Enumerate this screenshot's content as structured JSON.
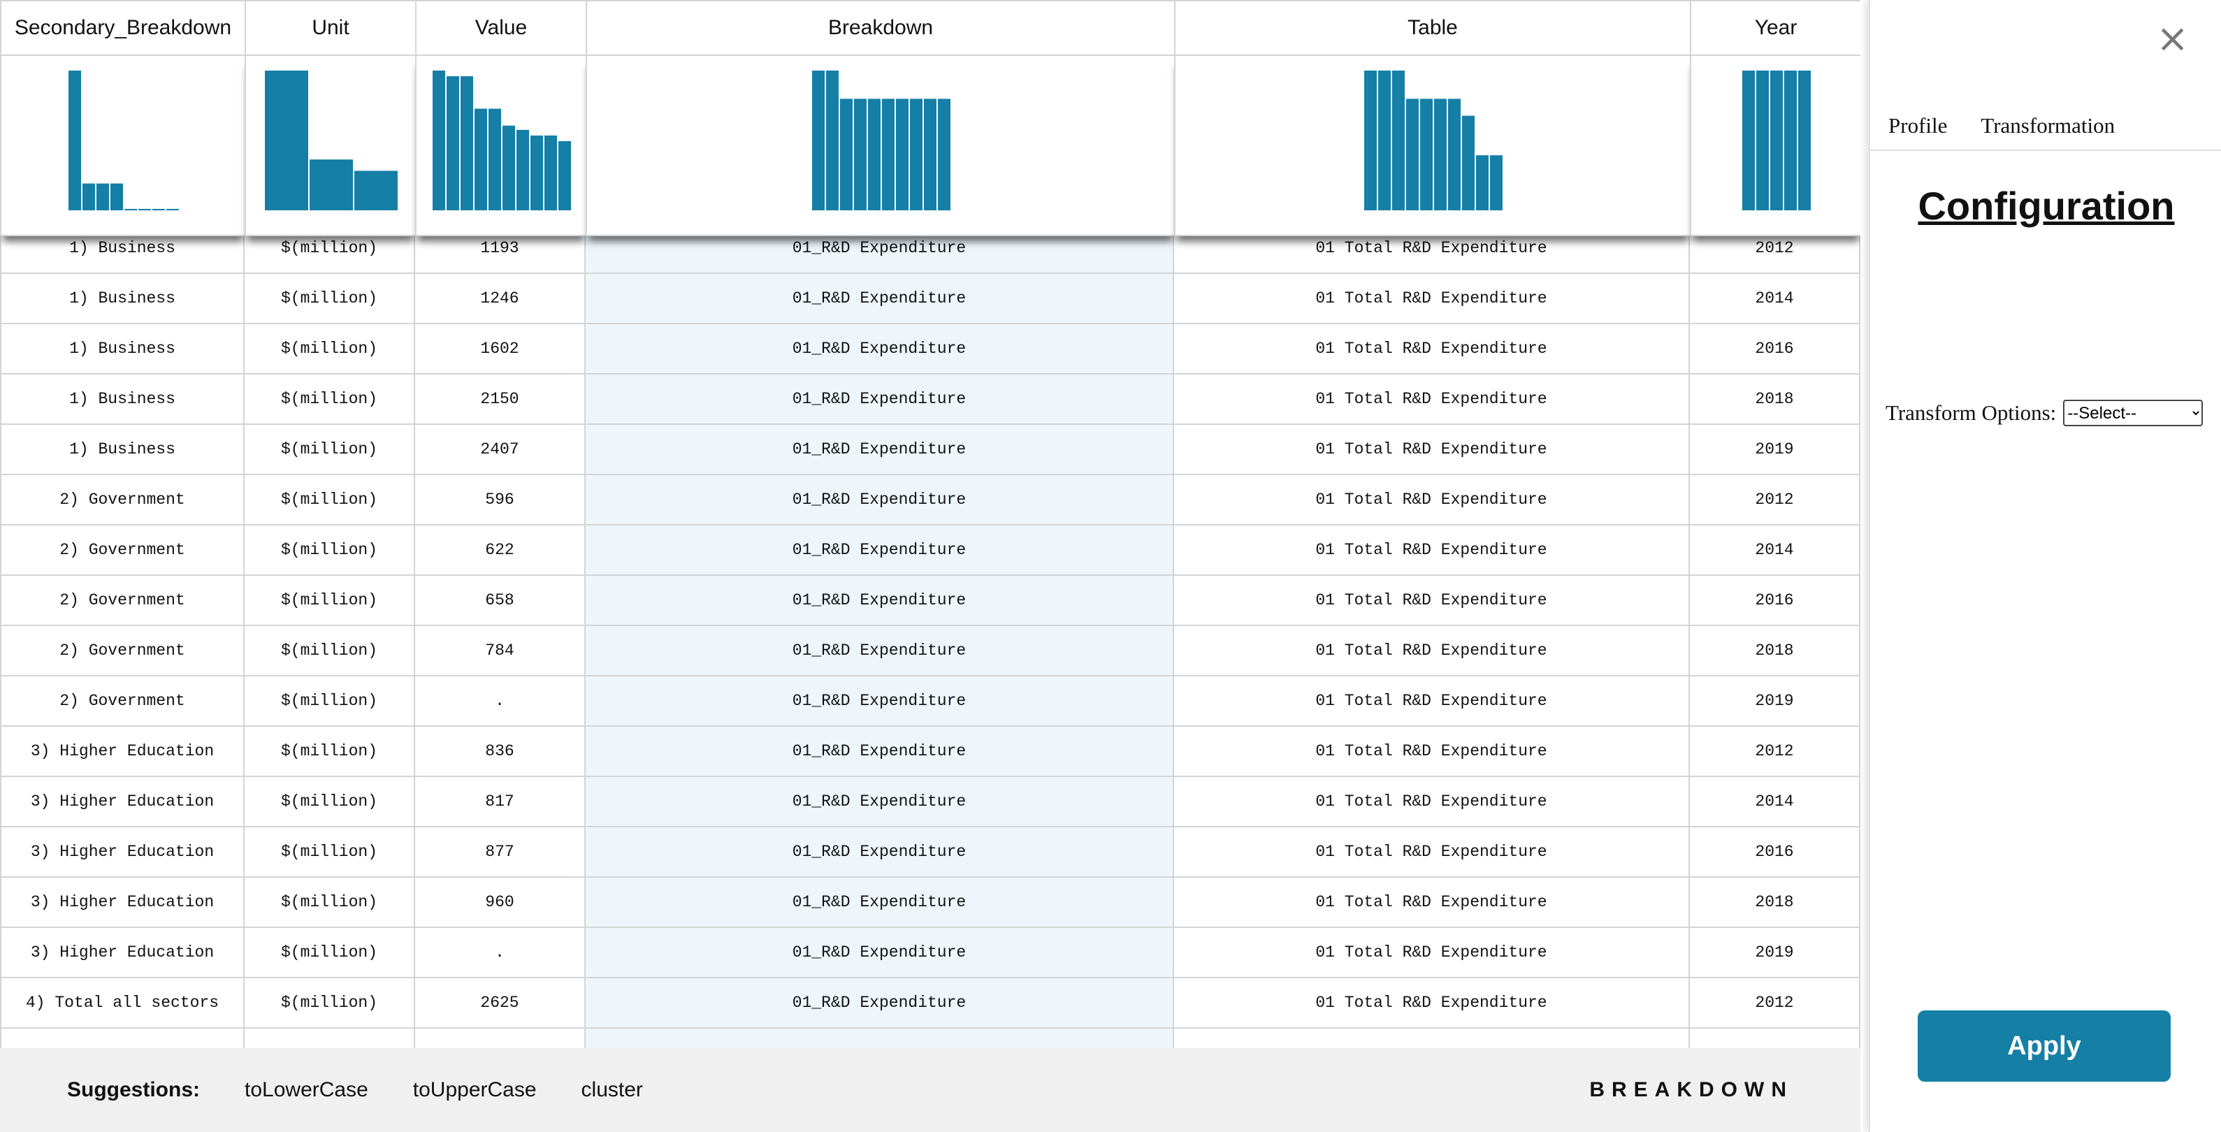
{
  "table": {
    "columns": [
      "Secondary_Breakdown",
      "Unit",
      "Value",
      "Breakdown",
      "Table",
      "Year"
    ],
    "rows": [
      [
        "1) Business",
        "$(million)",
        "1193",
        "01_R&D Expenditure",
        "01 Total R&D Expenditure",
        "2012"
      ],
      [
        "1) Business",
        "$(million)",
        "1246",
        "01_R&D Expenditure",
        "01 Total R&D Expenditure",
        "2014"
      ],
      [
        "1) Business",
        "$(million)",
        "1602",
        "01_R&D Expenditure",
        "01 Total R&D Expenditure",
        "2016"
      ],
      [
        "1) Business",
        "$(million)",
        "2150",
        "01_R&D Expenditure",
        "01 Total R&D Expenditure",
        "2018"
      ],
      [
        "1) Business",
        "$(million)",
        "2407",
        "01_R&D Expenditure",
        "01 Total R&D Expenditure",
        "2019"
      ],
      [
        "2) Government",
        "$(million)",
        "596",
        "01_R&D Expenditure",
        "01 Total R&D Expenditure",
        "2012"
      ],
      [
        "2) Government",
        "$(million)",
        "622",
        "01_R&D Expenditure",
        "01 Total R&D Expenditure",
        "2014"
      ],
      [
        "2) Government",
        "$(million)",
        "658",
        "01_R&D Expenditure",
        "01 Total R&D Expenditure",
        "2016"
      ],
      [
        "2) Government",
        "$(million)",
        "784",
        "01_R&D Expenditure",
        "01 Total R&D Expenditure",
        "2018"
      ],
      [
        "2) Government",
        "$(million)",
        ".",
        "01_R&D Expenditure",
        "01 Total R&D Expenditure",
        "2019"
      ],
      [
        "3) Higher Education",
        "$(million)",
        "836",
        "01_R&D Expenditure",
        "01 Total R&D Expenditure",
        "2012"
      ],
      [
        "3) Higher Education",
        "$(million)",
        "817",
        "01_R&D Expenditure",
        "01 Total R&D Expenditure",
        "2014"
      ],
      [
        "3) Higher Education",
        "$(million)",
        "877",
        "01_R&D Expenditure",
        "01 Total R&D Expenditure",
        "2016"
      ],
      [
        "3) Higher Education",
        "$(million)",
        "960",
        "01_R&D Expenditure",
        "01 Total R&D Expenditure",
        "2018"
      ],
      [
        "3) Higher Education",
        "$(million)",
        ".",
        "01_R&D Expenditure",
        "01 Total R&D Expenditure",
        "2019"
      ],
      [
        "4) Total all sectors",
        "$(million)",
        "2625",
        "01_R&D Expenditure",
        "01 Total R&D Expenditure",
        "2012"
      ],
      [
        "",
        "",
        "",
        "",
        "",
        ""
      ]
    ],
    "highlighted_column": "Breakdown"
  },
  "chart_data": [
    {
      "type": "bar",
      "column": "Secondary_Breakdown",
      "values": [
        100,
        20,
        20,
        20,
        2,
        2,
        2,
        2
      ]
    },
    {
      "type": "bar",
      "column": "Unit",
      "values": [
        100,
        37,
        29
      ]
    },
    {
      "type": "bar",
      "column": "Value",
      "values": [
        100,
        96,
        96,
        73,
        73,
        61,
        58,
        54,
        54,
        50
      ]
    },
    {
      "type": "bar",
      "column": "Breakdown",
      "values": [
        100,
        100,
        80,
        80,
        80,
        80,
        80,
        80,
        80,
        80
      ]
    },
    {
      "type": "bar",
      "column": "Table",
      "values": [
        100,
        100,
        100,
        80,
        80,
        80,
        80,
        68,
        40,
        40
      ]
    },
    {
      "type": "bar",
      "column": "Year",
      "values": [
        100,
        100,
        100,
        100,
        100
      ]
    }
  ],
  "histogram_color": "#157fa6",
  "suggestions": {
    "label": "Suggestions:",
    "items": [
      "toLowerCase",
      "toUpperCase",
      "cluster"
    ],
    "selected_column_name": "BREAKDOWN"
  },
  "panel": {
    "close_icon": "×",
    "tabs": [
      "Profile",
      "Transformation"
    ],
    "title": "Configuration",
    "transform_label": "Transform Options:",
    "transform_selected": "--Select--",
    "apply_label": "Apply",
    "accent": "#157fa6"
  }
}
